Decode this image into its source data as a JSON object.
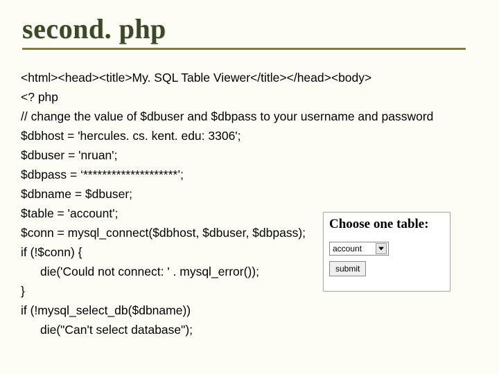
{
  "title": "second. php",
  "code_lines": [
    "<html><head><title>My. SQL Table Viewer</title></head><body>",
    "<? php",
    "// change the value of $dbuser and $dbpass to your username and password",
    "$dbhost = 'hercules. cs. kent. edu: 3306';",
    "$dbuser = 'nruan';",
    "$dbpass = ‘********************’;",
    "$dbname = $dbuser;",
    "$table = 'account';",
    "$conn = mysql_connect($dbhost, $dbuser, $dbpass);",
    "if (!$conn) {",
    "    die('Could not connect: ' . mysql_error());",
    "}",
    "if (!mysql_select_db($dbname))",
    "    die(\"Can't select database\");"
  ],
  "inset": {
    "heading": "Choose one table:",
    "selected": "account",
    "submit_label": "submit"
  }
}
